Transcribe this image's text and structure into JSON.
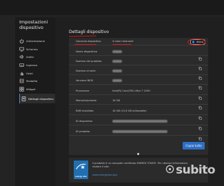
{
  "app": {
    "title": "Impostazioni dispositivo"
  },
  "sidebar": {
    "items": [
      {
        "label": "Alimentazione",
        "icon": "power-icon"
      },
      {
        "label": "Schermo",
        "icon": "monitor-icon"
      },
      {
        "label": "Audio",
        "icon": "speaker-icon"
      },
      {
        "label": "Ingresso",
        "icon": "keyboard-icon"
      },
      {
        "label": "Gesti",
        "icon": "hand-icon"
      },
      {
        "label": "Modalità",
        "icon": "mode-icon"
      },
      {
        "label": "Widget",
        "icon": "widget-icon"
      },
      {
        "label": "Dettagli dispositivo",
        "icon": "device-details-icon"
      }
    ],
    "active_index": 7
  },
  "details": {
    "title": "Dettagli dispositivo",
    "warranty": {
      "label": "Garanzia dispositivo",
      "value": "4 mesi rimanenti",
      "toggle_label": "Attivo"
    },
    "rows": [
      {
        "label": "Nome dispositivo",
        "value": ""
      },
      {
        "label": "Numero del prodotto",
        "value": ""
      },
      {
        "label": "Numero di serie",
        "value": ""
      },
      {
        "label": "Versione BIOS",
        "value": ""
      },
      {
        "label": "Processore",
        "value": "Intel(R) Core(TM) Ultra 7 155H"
      },
      {
        "label": "Memoria/scheda",
        "value": "16 GB"
      },
      {
        "label": "RAM installata",
        "value": "16 GB (15,6 GB utilizzabile)"
      },
      {
        "label": "ID dispositivo",
        "value": ""
      },
      {
        "label": "ID prodotto",
        "value": ""
      }
    ],
    "copy_all_label": "Copia tutto"
  },
  "energy": {
    "text": "Il prodotto è un computer certificato ENERGY STAR®. Per ulteriori informazioni, visitare il sito:",
    "link": "www.energystar.gov",
    "badge": "energy star"
  },
  "watermark": {
    "text": "subito"
  },
  "colors": {
    "accent": "#2e6fc6",
    "annotation_red": "#d11a1a",
    "energy_star_blue": "#1f6fb2"
  }
}
